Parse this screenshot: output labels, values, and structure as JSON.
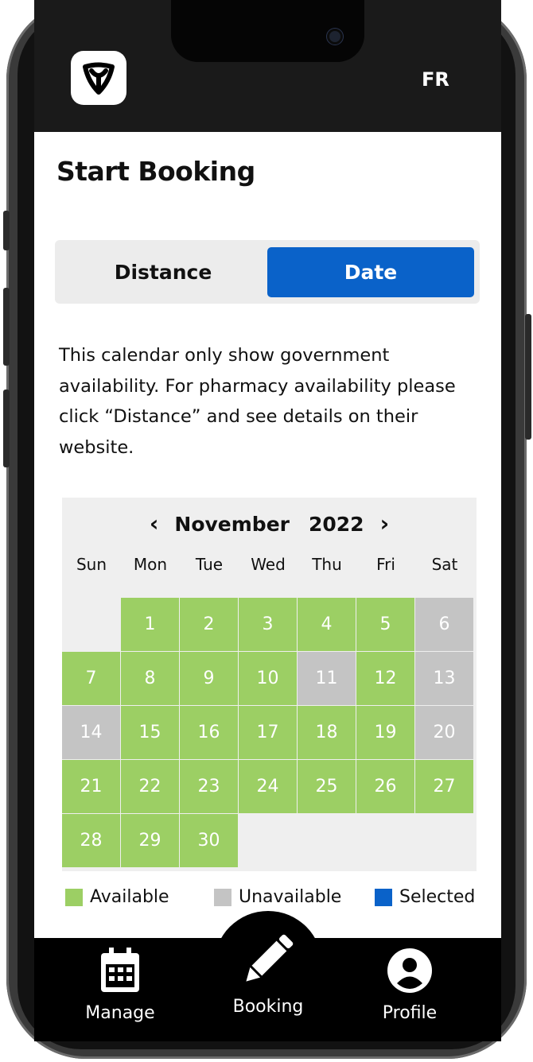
{
  "app": {
    "lang_toggle": "FR",
    "logo_icon": "ontario-trillium-icon"
  },
  "page": {
    "title": "Start Booking"
  },
  "segmented": {
    "options": [
      "Distance",
      "Date"
    ],
    "selected": "Date"
  },
  "info_text": "This calendar only show government availability. For pharmacy availability please click “Distance” and see details on their website.",
  "calendar": {
    "month": "November",
    "year": "2022",
    "prev_icon": "chevron-left-icon",
    "next_icon": "chevron-right-icon",
    "weekdays": [
      "Sun",
      "Mon",
      "Tue",
      "Wed",
      "Thu",
      "Fri",
      "Sat"
    ],
    "start_weekday": 1,
    "days": [
      {
        "day": "1",
        "status": "available"
      },
      {
        "day": "2",
        "status": "available"
      },
      {
        "day": "3",
        "status": "available"
      },
      {
        "day": "4",
        "status": "available"
      },
      {
        "day": "5",
        "status": "available"
      },
      {
        "day": "6",
        "status": "unavailable"
      },
      {
        "day": "7",
        "status": "available"
      },
      {
        "day": "8",
        "status": "available"
      },
      {
        "day": "9",
        "status": "available"
      },
      {
        "day": "10",
        "status": "available"
      },
      {
        "day": "11",
        "status": "unavailable"
      },
      {
        "day": "12",
        "status": "available"
      },
      {
        "day": "13",
        "status": "unavailable"
      },
      {
        "day": "14",
        "status": "unavailable"
      },
      {
        "day": "15",
        "status": "available"
      },
      {
        "day": "16",
        "status": "available"
      },
      {
        "day": "17",
        "status": "available"
      },
      {
        "day": "18",
        "status": "available"
      },
      {
        "day": "19",
        "status": "available"
      },
      {
        "day": "20",
        "status": "unavailable"
      },
      {
        "day": "21",
        "status": "available"
      },
      {
        "day": "22",
        "status": "available"
      },
      {
        "day": "23",
        "status": "available"
      },
      {
        "day": "24",
        "status": "available"
      },
      {
        "day": "25",
        "status": "available"
      },
      {
        "day": "26",
        "status": "available"
      },
      {
        "day": "27",
        "status": "available"
      },
      {
        "day": "28",
        "status": "available"
      },
      {
        "day": "29",
        "status": "available"
      },
      {
        "day": "30",
        "status": "available"
      }
    ]
  },
  "legend": [
    {
      "label": "Available",
      "color": "#9ccf64"
    },
    {
      "label": "Unavailable",
      "color": "#c4c4c4"
    },
    {
      "label": "Selected",
      "color": "#0a62c9"
    }
  ],
  "nav": {
    "items": [
      {
        "label": "Manage",
        "icon": "calendar-icon"
      },
      {
        "label": "Booking",
        "icon": "pencil-icon"
      },
      {
        "label": "Profile",
        "icon": "user-profile-icon"
      }
    ]
  },
  "colors": {
    "accent": "#0a62c9",
    "available": "#9ccf64",
    "unavailable": "#c4c4c4",
    "header_bg": "#1a1a1a"
  }
}
